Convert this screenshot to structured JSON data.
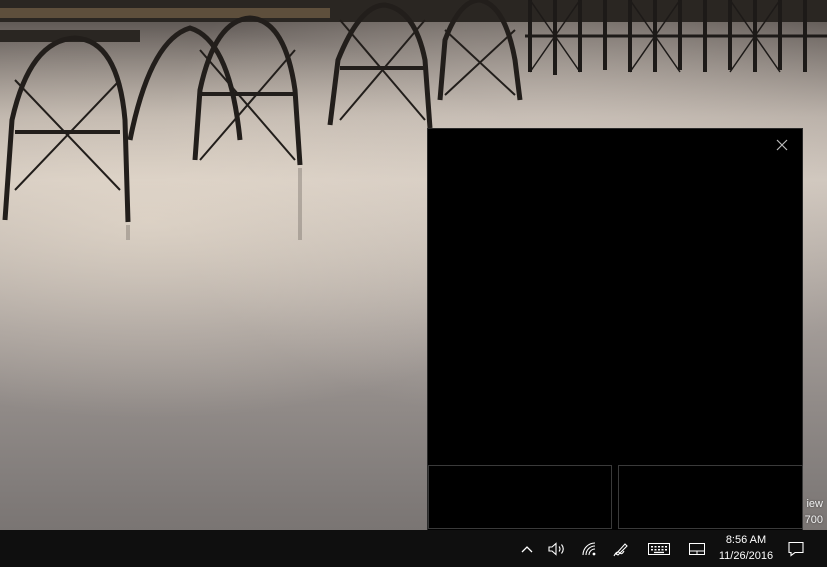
{
  "desktop": {
    "watermark_line1": "iew",
    "watermark_line2": "700"
  },
  "touchpad_flyout": {
    "close_glyph": "✕"
  },
  "taskbar": {
    "clock": {
      "time": "8:56 AM",
      "date": "11/26/2016"
    },
    "tray_icons": [
      "chevron-up-icon",
      "volume-icon",
      "network-icon",
      "pen-workspace-icon",
      "touch-keyboard-icon",
      "touchpad-icon",
      "action-center-icon"
    ]
  },
  "colors": {
    "taskbar": "#0f0f0f",
    "flyout": "#000000",
    "icon": "#ffffff"
  }
}
